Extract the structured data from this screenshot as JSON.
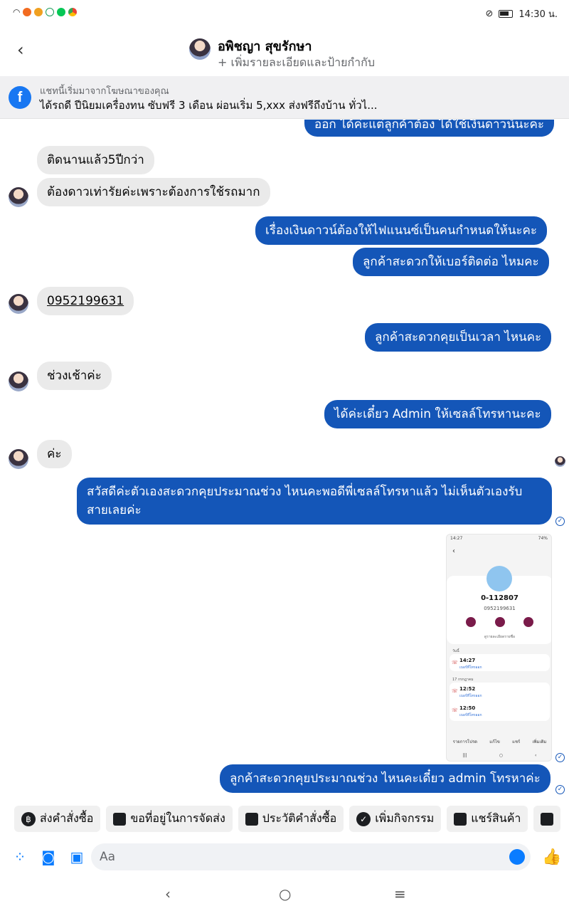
{
  "status": {
    "time": "14:30 น."
  },
  "header": {
    "name": "อพิชญา สุขรักษา",
    "subtitle": "+ เพิ่มรายละเอียดและป้ายกำกับ"
  },
  "banner": {
    "line1": "แชทนี้เริ่มมาจากโฆษณาของคุณ",
    "line2": "ได้รถดี ปีนิยมเครื่องทน ซับฟรี 3 เดือน ผ่อนเริ่ม 5,xxx  ส่งฟรีถึงบ้าน ทั่วไ..."
  },
  "messages": [
    {
      "side": "out",
      "text": "ออก ได้ค่ะแต่ลูกค้าต้อง ได้ใช้เงินดาวน์นะคะ"
    },
    {
      "side": "in",
      "text": "ติดนานแล้ว5ปีกว่า"
    },
    {
      "side": "in",
      "text": "ต้องดาวเท่ารัยค่ะเพราะต้องการใช้รถมาก"
    },
    {
      "side": "out",
      "text": "เรื่องเงินดาวน์ต้องให้ไฟแนนซ์เป็นคนกำหนดให้นะคะ"
    },
    {
      "side": "out",
      "text": "ลูกค้าสะดวกให้เบอร์ติดต่อ ไหมคะ"
    },
    {
      "side": "in",
      "text": "0952199631"
    },
    {
      "side": "out",
      "text": "ลูกค้าสะดวกคุยเป็นเวลา ไหนคะ"
    },
    {
      "side": "in",
      "text": "ช่วงเช้าค่ะ"
    },
    {
      "side": "out",
      "text": "ได้ค่ะเดี๋ยว Admin ให้เซลล์โทรหานะคะ"
    },
    {
      "side": "in",
      "text": "ค่ะ"
    },
    {
      "side": "out",
      "text_line1": "สวัสดีค่ะตัวเองสะดวกคุยประมาณช่วง ไหนคะพอดีพี่เซลล์โทรหาแล้ว ไม่เห็นตัวเองรับ",
      "text_line2": "สายเลยค่ะ"
    },
    {
      "side": "out",
      "text": "ลูกค้าสะดวกคุยประมาณช่วง ไหนคะเดี๋ยว admin โทรหาค่ะ"
    }
  ],
  "screenshot_attachment": {
    "time": "14:27",
    "battery": "74%",
    "contact": "0-112807",
    "phone": "0952199631",
    "details_label": "ดูรายละเอียดรายชื่อ",
    "today_label": "วันนี้",
    "older_label": "17 กรกฎาคม",
    "calls": [
      {
        "time": "14:27",
        "note": "เบอร์ที่โทรออก"
      },
      {
        "time": "12:52",
        "note": "เบอร์ที่โทรออก"
      },
      {
        "time": "12:50",
        "note": "เบอร์ที่โทรออก"
      }
    ],
    "bottom": [
      "รายการโปรด",
      "แก้ไข",
      "แชร์",
      "เพิ่มเติม"
    ]
  },
  "quick_replies": [
    "ส่งคำสั่งซื้อ",
    "ขอที่อยู่ในการจัดส่ง",
    "ประวัติคำสั่งซื้อ",
    "เพิ่มกิจกรรม",
    "แชร์สินค้า"
  ],
  "composer": {
    "placeholder": "Aa"
  }
}
